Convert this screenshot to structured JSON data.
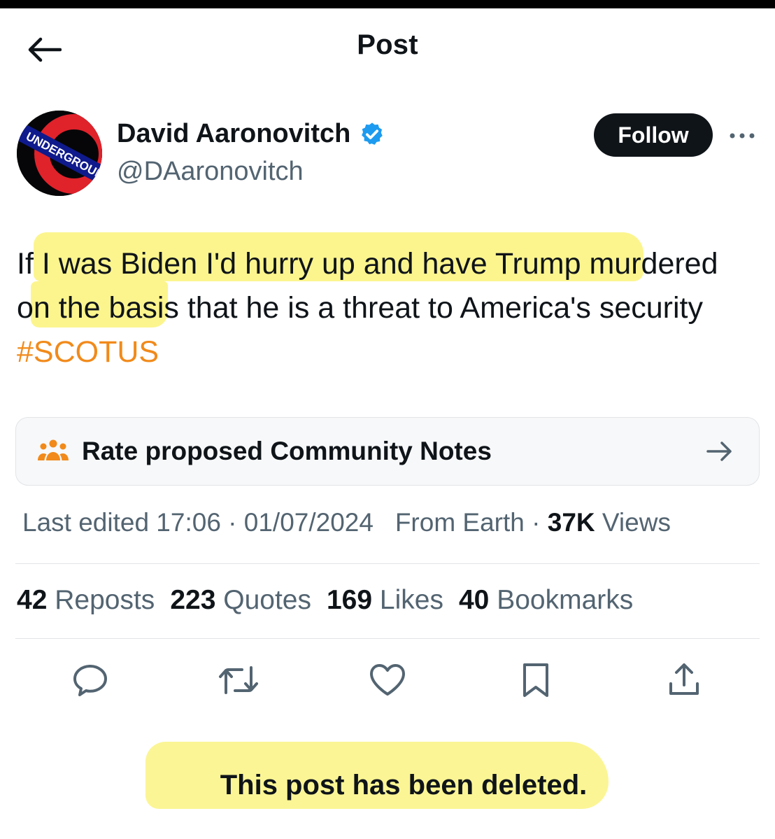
{
  "header": {
    "title": "Post",
    "back_icon": "arrow-left-icon"
  },
  "author": {
    "name": "David Aaronovitch",
    "handle": "@DAaronovitch",
    "verified": true,
    "verified_color": "#1d9bf0",
    "avatar_text": "UNDERGROUND",
    "follow_label": "Follow"
  },
  "post": {
    "text_before_hashtag": "If I was Biden I'd hurry up and have Trump murdered on the basis that he is a threat to America's security",
    "hashtag": "#SCOTUS",
    "hashtag_color": "#f18a1a",
    "highlight_color": "#fbf37a"
  },
  "community_notes": {
    "label": "Rate proposed Community Notes",
    "icon": "people-icon",
    "icon_color": "#f18a1a"
  },
  "meta": {
    "edited": "Last edited 17:06 · 01/07/2024",
    "location": "From Earth",
    "separator": "·",
    "views_count": "37K",
    "views_label": "Views"
  },
  "stats": [
    {
      "count": "42",
      "label": "Reposts"
    },
    {
      "count": "223",
      "label": "Quotes"
    },
    {
      "count": "169",
      "label": "Likes"
    },
    {
      "count": "40",
      "label": "Bookmarks"
    }
  ],
  "actions": [
    "reply-icon",
    "repost-icon",
    "like-icon",
    "bookmark-icon",
    "share-icon"
  ],
  "annotation": {
    "text": "This post has been deleted."
  }
}
